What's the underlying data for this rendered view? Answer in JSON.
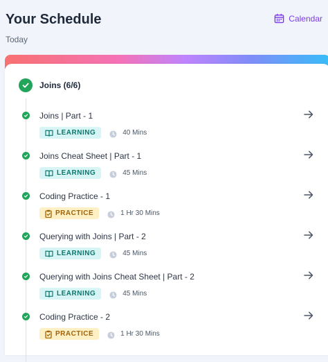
{
  "header": {
    "title": "Your Schedule",
    "subtitle": "Today",
    "calendar_label": "Calendar"
  },
  "colors": {
    "accent": "#7c3aed",
    "success": "#22a55a",
    "learning_bg": "#d6f5f4",
    "learning_fg": "#0f766e",
    "practice_bg": "#fdf0c4",
    "practice_fg": "#a16207"
  },
  "group": {
    "title": "Joins (6/6)",
    "icon": "check-circle-icon",
    "items": [
      {
        "title": "Joins | Part - 1",
        "type": "LEARNING",
        "duration": "40 Mins",
        "icon": "book-icon"
      },
      {
        "title": "Joins Cheat Sheet | Part - 1",
        "type": "LEARNING",
        "duration": "45 Mins",
        "icon": "book-icon"
      },
      {
        "title": "Coding Practice - 1",
        "type": "PRACTICE",
        "duration": "1 Hr 30 Mins",
        "icon": "clipboard-icon"
      },
      {
        "title": "Querying with Joins | Part - 2",
        "type": "LEARNING",
        "duration": "45 Mins",
        "icon": "book-icon"
      },
      {
        "title": "Querying with Joins Cheat Sheet | Part - 2",
        "type": "LEARNING",
        "duration": "45 Mins",
        "icon": "book-icon"
      },
      {
        "title": "Coding Practice - 2",
        "type": "PRACTICE",
        "duration": "1 Hr 30 Mins",
        "icon": "clipboard-icon"
      }
    ]
  }
}
